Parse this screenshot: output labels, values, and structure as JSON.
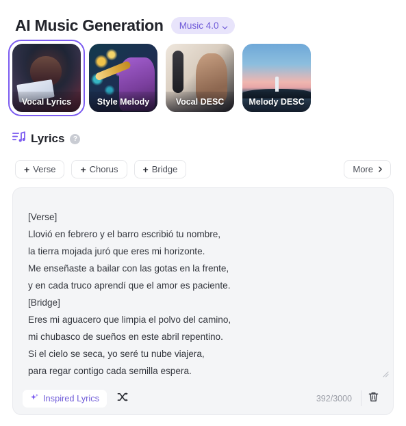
{
  "header": {
    "title": "AI Music Generation",
    "model_badge": {
      "label": "Music 4.0",
      "icon": "chevron-down-icon"
    },
    "accent_color": "#6f5bd8",
    "badge_bg": "#e8e4fb"
  },
  "mode_cards": [
    {
      "label": "Vocal Lyrics",
      "selected": true,
      "art": "t-vocal"
    },
    {
      "label": "Style Melody",
      "selected": false,
      "art": "t-style"
    },
    {
      "label": "Vocal DESC",
      "selected": false,
      "art": "t-vdesc"
    },
    {
      "label": "Melody DESC",
      "selected": false,
      "art": "t-mdesc"
    }
  ],
  "lyrics_section": {
    "title": "Lyrics",
    "icon": "playlist-music-icon",
    "help_icon": "help-circle-icon",
    "help_glyph": "?",
    "chips": [
      {
        "plus": "+",
        "label": "Verse"
      },
      {
        "plus": "+",
        "label": "Chorus"
      },
      {
        "plus": "+",
        "label": "Bridge"
      }
    ],
    "more": {
      "label": "More",
      "icon": "chevron-right-icon"
    }
  },
  "editor": {
    "lines": [
      "[Verse]",
      "Llovió en febrero y el barro escribió tu nombre,",
      "la tierra mojada juró que eres mi horizonte.",
      "Me enseñaste a bailar con las gotas en la frente,",
      "y en cada truco aprendí que el amor es paciente.",
      "[Bridge]",
      "Eres mi aguacero que limpia el polvo del camino,",
      "mi chubasco de sueños en este abril repentino.",
      "Si el cielo se seca, yo seré tu nube viajera,",
      "para regar contigo cada semilla espera."
    ]
  },
  "toolbar": {
    "inspired_label": "Inspired Lyrics",
    "inspired_icon": "sparkle-icon",
    "shuffle_icon": "shuffle-icon",
    "counter": "392/3000",
    "trash_icon": "trash-icon"
  }
}
